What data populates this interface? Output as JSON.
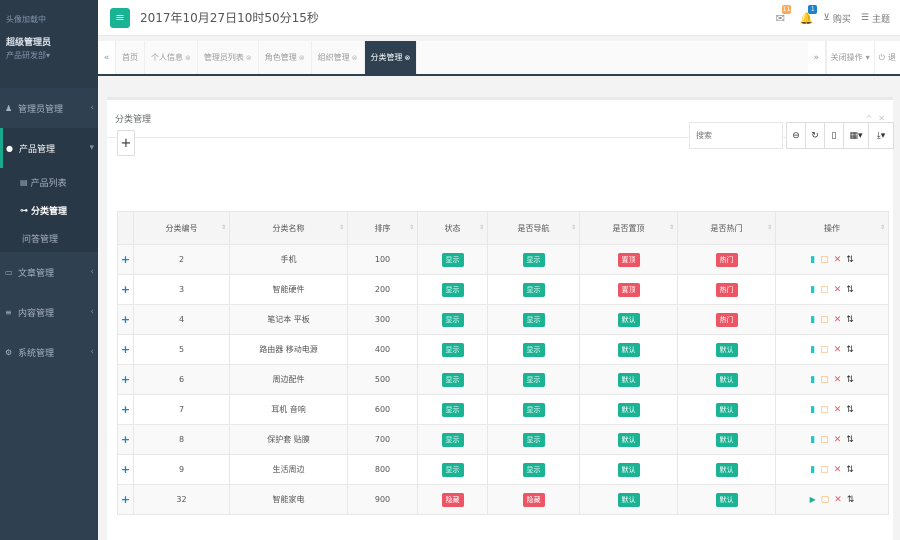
{
  "sidebar": {
    "welcome": "头像加载中",
    "user_name": "超级管理员",
    "department": "产品研发部",
    "menu": [
      {
        "label": "管理员管理",
        "icon": "user-icon"
      },
      {
        "label": "产品管理",
        "icon": "circle-icon",
        "active": true,
        "children": [
          {
            "label": "产品列表",
            "icon": "list-icon"
          },
          {
            "label": "分类管理",
            "icon": "sitemap-icon",
            "active": true
          },
          {
            "label": "问答管理"
          }
        ]
      },
      {
        "label": "文章管理",
        "icon": "article-icon"
      },
      {
        "label": "内容管理",
        "icon": "content-icon"
      },
      {
        "label": "系统管理",
        "icon": "settings-icon"
      }
    ]
  },
  "header": {
    "datetime": "2017年10月27日10时50分15秒",
    "badge_notices": "11",
    "badge_messages": "1",
    "buy_label": "购买",
    "theme_label": "主题"
  },
  "tabs": {
    "items": [
      "首页",
      "个人信息",
      "管理员列表",
      "角色管理",
      "组织管理",
      "分类管理"
    ],
    "close_ops_label": "关闭操作",
    "exit_label": "退"
  },
  "panel": {
    "title": "分类管理",
    "search_placeholder": "搜索"
  },
  "table": {
    "headers": [
      "分类编号",
      "分类名称",
      "排序",
      "状态",
      "是否导航",
      "是否置顶",
      "是否热门",
      "操作"
    ],
    "rows": [
      {
        "id": "2",
        "name": "手机",
        "sort": "100",
        "status": "显示",
        "nav": "显示",
        "top": "置顶",
        "hot": "热门"
      },
      {
        "id": "3",
        "name": "智能硬件",
        "sort": "200",
        "status": "显示",
        "nav": "显示",
        "top": "置顶",
        "hot": "热门"
      },
      {
        "id": "4",
        "name": "笔记本 平板",
        "sort": "300",
        "status": "显示",
        "nav": "显示",
        "top": "默认",
        "hot": "热门"
      },
      {
        "id": "5",
        "name": "路由器 移动电源",
        "sort": "400",
        "status": "显示",
        "nav": "显示",
        "top": "默认",
        "hot": "默认"
      },
      {
        "id": "6",
        "name": "周边配件",
        "sort": "500",
        "status": "显示",
        "nav": "显示",
        "top": "默认",
        "hot": "默认"
      },
      {
        "id": "7",
        "name": "耳机 音响",
        "sort": "600",
        "status": "显示",
        "nav": "显示",
        "top": "默认",
        "hot": "默认"
      },
      {
        "id": "8",
        "name": "保护套 贴膜",
        "sort": "700",
        "status": "显示",
        "nav": "显示",
        "top": "默认",
        "hot": "默认"
      },
      {
        "id": "9",
        "name": "生活周边",
        "sort": "800",
        "status": "显示",
        "nav": "显示",
        "top": "默认",
        "hot": "默认"
      },
      {
        "id": "32",
        "name": "智能家电",
        "sort": "900",
        "status": "隐藏",
        "nav": "隐藏",
        "top": "默认",
        "hot": "默认"
      }
    ]
  },
  "colors": {
    "sidebar_bg": "#2f4050",
    "accent_green": "#1ab394",
    "accent_red": "#ed5565"
  }
}
